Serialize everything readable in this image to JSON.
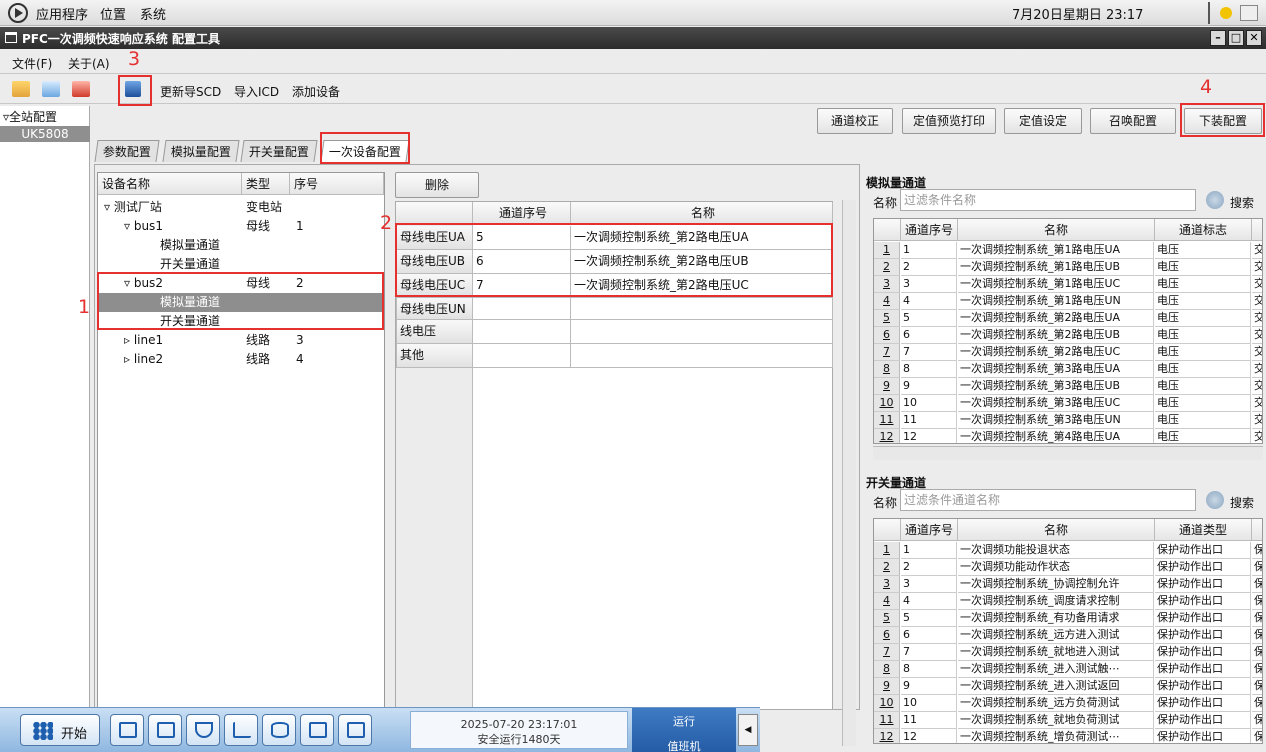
{
  "system_bar": {
    "menu_apps": "应用程序",
    "menu_places": "位置",
    "menu_system": "系统",
    "clock": "7月20日星期日 23:17"
  },
  "window": {
    "title": "PFC一次调频快速响应系统 配置工具"
  },
  "menubar": {
    "file": "文件(F)",
    "about": "关于(A)"
  },
  "toolbar": {
    "update_scd": "更新导SCD",
    "import_icd": "导入ICD",
    "add_device": "添加设备"
  },
  "sidebar": {
    "root": "▿全站配置",
    "selected": "UK5808"
  },
  "actions": {
    "channel_calibrate": "通道校正",
    "preview_print": "定值预览打印",
    "setting": "定值设定",
    "call_config": "召唤配置",
    "download_config": "下装配置"
  },
  "tabs": [
    "参数配置",
    "模拟量配置",
    "开关量配置",
    "一次设备配置"
  ],
  "annotations": [
    "1",
    "2",
    "3",
    "4"
  ],
  "device_tree": {
    "headers": [
      "设备名称",
      "类型",
      "序号"
    ],
    "rows": [
      {
        "name": "▿ 测试厂站",
        "type": "变电站",
        "no": ""
      },
      {
        "name": "▿ bus1",
        "type": "母线",
        "no": "1"
      },
      {
        "name": "模拟量通道",
        "type": "",
        "no": ""
      },
      {
        "name": "开关量通道",
        "type": "",
        "no": ""
      },
      {
        "name": "▿ bus2",
        "type": "母线",
        "no": "2"
      },
      {
        "name": "模拟量通道",
        "type": "",
        "no": ""
      },
      {
        "name": "开关量通道",
        "type": "",
        "no": ""
      },
      {
        "name": "▹ line1",
        "type": "线路",
        "no": "3"
      },
      {
        "name": "▹ line2",
        "type": "线路",
        "no": "4"
      }
    ]
  },
  "mapping": {
    "delete": "删除",
    "headers": [
      "通道序号",
      "名称"
    ],
    "rows": [
      {
        "label": "母线电压UA",
        "no": "5",
        "name": "一次调频控制系统_第2路电压UA"
      },
      {
        "label": "母线电压UB",
        "no": "6",
        "name": "一次调频控制系统_第2路电压UB"
      },
      {
        "label": "母线电压UC",
        "no": "7",
        "name": "一次调频控制系统_第2路电压UC"
      },
      {
        "label": "母线电压UN",
        "no": "",
        "name": ""
      },
      {
        "label": "线电压",
        "no": "",
        "name": ""
      },
      {
        "label": "其他",
        "no": "",
        "name": ""
      }
    ]
  },
  "analog": {
    "section": "模拟量通道",
    "name_label": "名称",
    "placeholder": "过滤条件名称",
    "search": "搜索",
    "headers": [
      "通道序号",
      "名称",
      "通道标志"
    ],
    "rows": [
      {
        "n": "1",
        "a": "1",
        "b": "一次调频控制系统_第1路电压UA",
        "c": "电压",
        "d": "交"
      },
      {
        "n": "2",
        "a": "2",
        "b": "一次调频控制系统_第1路电压UB",
        "c": "电压",
        "d": "交"
      },
      {
        "n": "3",
        "a": "3",
        "b": "一次调频控制系统_第1路电压UC",
        "c": "电压",
        "d": "交"
      },
      {
        "n": "4",
        "a": "4",
        "b": "一次调频控制系统_第1路电压UN",
        "c": "电压",
        "d": "交"
      },
      {
        "n": "5",
        "a": "5",
        "b": "一次调频控制系统_第2路电压UA",
        "c": "电压",
        "d": "交"
      },
      {
        "n": "6",
        "a": "6",
        "b": "一次调频控制系统_第2路电压UB",
        "c": "电压",
        "d": "交"
      },
      {
        "n": "7",
        "a": "7",
        "b": "一次调频控制系统_第2路电压UC",
        "c": "电压",
        "d": "交"
      },
      {
        "n": "8",
        "a": "8",
        "b": "一次调频控制系统_第3路电压UA",
        "c": "电压",
        "d": "交"
      },
      {
        "n": "9",
        "a": "9",
        "b": "一次调频控制系统_第3路电压UB",
        "c": "电压",
        "d": "交"
      },
      {
        "n": "10",
        "a": "10",
        "b": "一次调频控制系统_第3路电压UC",
        "c": "电压",
        "d": "交"
      },
      {
        "n": "11",
        "a": "11",
        "b": "一次调频控制系统_第3路电压UN",
        "c": "电压",
        "d": "交"
      },
      {
        "n": "12",
        "a": "12",
        "b": "一次调频控制系统_第4路电压UA",
        "c": "电压",
        "d": "交"
      }
    ]
  },
  "switch": {
    "section": "开关量通道",
    "name_label": "名称",
    "placeholder": "过滤条件通道名称",
    "search": "搜索",
    "headers": [
      "通道序号",
      "名称",
      "通道类型"
    ],
    "rows": [
      {
        "n": "1",
        "a": "1",
        "b": "一次调频功能投退状态",
        "c": "保护动作出口",
        "d": "保"
      },
      {
        "n": "2",
        "a": "2",
        "b": "一次调频功能动作状态",
        "c": "保护动作出口",
        "d": "保"
      },
      {
        "n": "3",
        "a": "3",
        "b": "一次调频控制系统_协调控制允许",
        "c": "保护动作出口",
        "d": "保"
      },
      {
        "n": "4",
        "a": "4",
        "b": "一次调频控制系统_调度请求控制",
        "c": "保护动作出口",
        "d": "保"
      },
      {
        "n": "5",
        "a": "5",
        "b": "一次调频控制系统_有功备用请求",
        "c": "保护动作出口",
        "d": "保"
      },
      {
        "n": "6",
        "a": "6",
        "b": "一次调频控制系统_远方进入测试",
        "c": "保护动作出口",
        "d": "保"
      },
      {
        "n": "7",
        "a": "7",
        "b": "一次调频控制系统_就地进入测试",
        "c": "保护动作出口",
        "d": "保"
      },
      {
        "n": "8",
        "a": "8",
        "b": "一次调频控制系统_进入测试触⋯",
        "c": "保护动作出口",
        "d": "保"
      },
      {
        "n": "9",
        "a": "9",
        "b": "一次调频控制系统_进入测试返回",
        "c": "保护动作出口",
        "d": "保"
      },
      {
        "n": "10",
        "a": "10",
        "b": "一次调频控制系统_远方负荷测试",
        "c": "保护动作出口",
        "d": "保"
      },
      {
        "n": "11",
        "a": "11",
        "b": "一次调频控制系统_就地负荷测试",
        "c": "保护动作出口",
        "d": "保"
      },
      {
        "n": "12",
        "a": "12",
        "b": "一次调频控制系统_增负荷测试⋯",
        "c": "保护动作出口",
        "d": "保"
      }
    ]
  },
  "taskbar": {
    "start": "开始",
    "datetime": "2025-07-20 23:17:01",
    "uptime": "安全运行1480天",
    "run": "运行",
    "duty": "值班机"
  }
}
